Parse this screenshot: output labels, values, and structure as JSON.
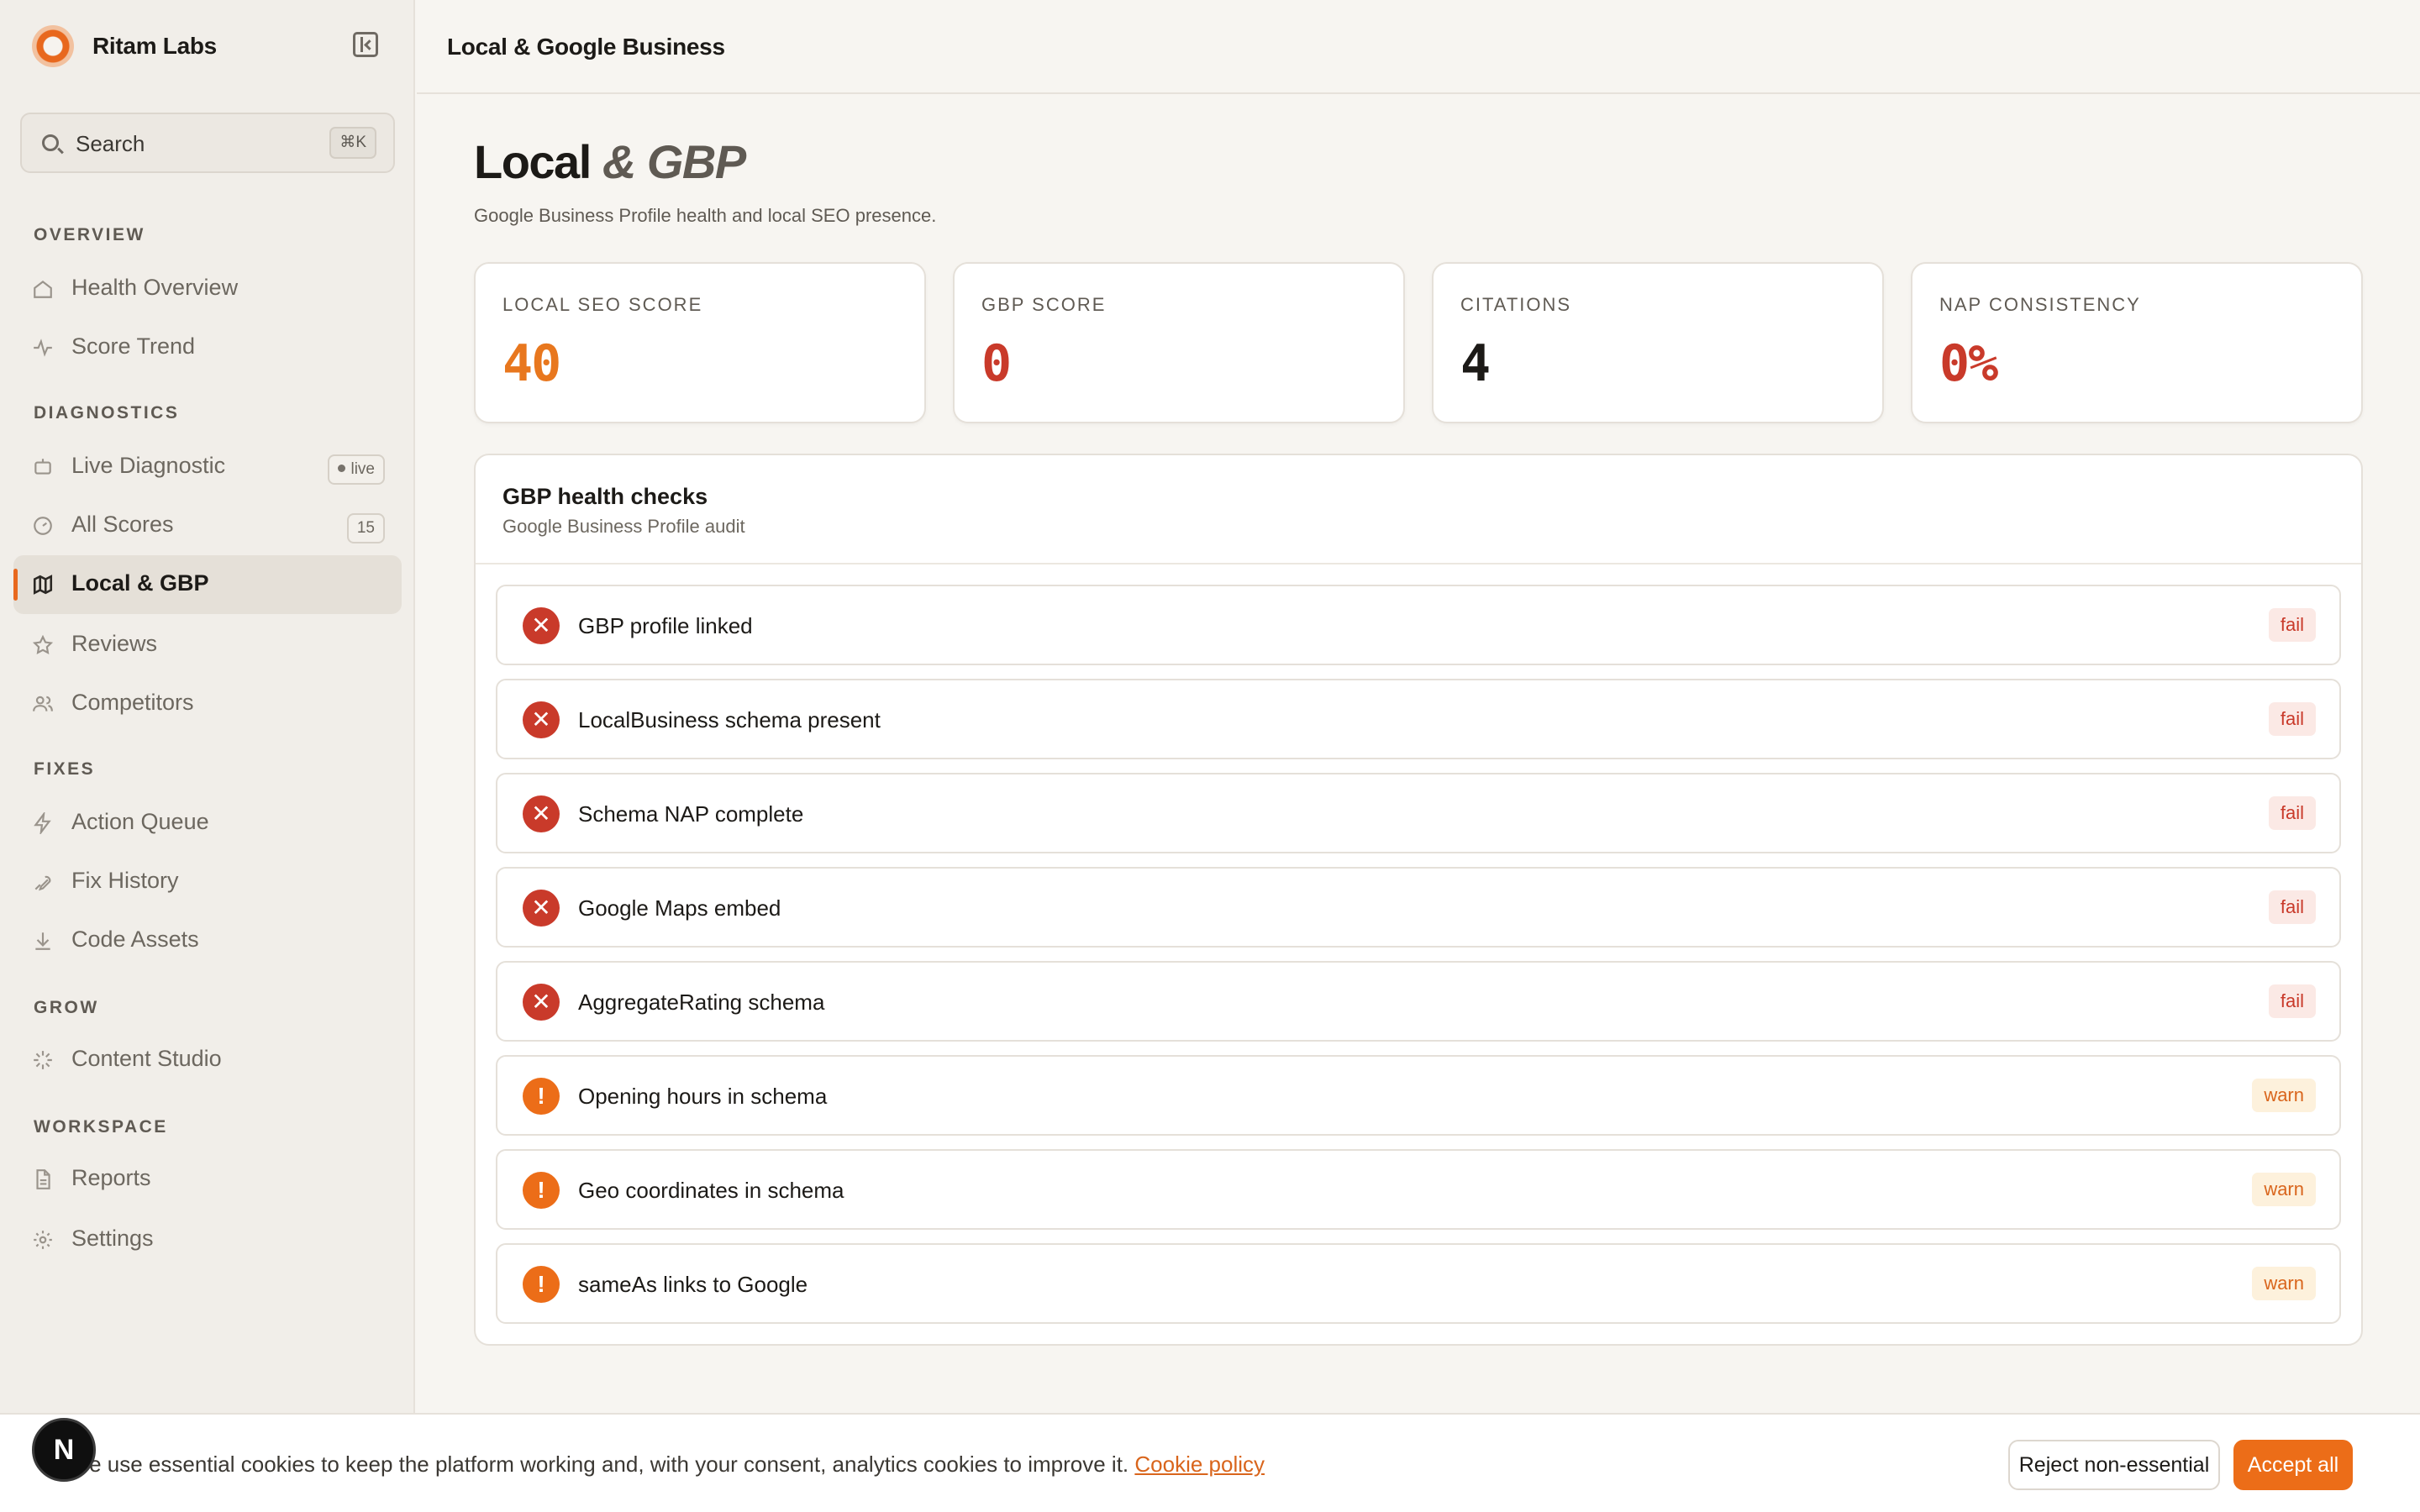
{
  "brand": {
    "name": "Ritam Labs"
  },
  "search": {
    "placeholder": "Search",
    "shortcut": "⌘K"
  },
  "sidebar": {
    "sections": [
      {
        "label": "OVERVIEW"
      },
      {
        "label": "DIAGNOSTICS"
      },
      {
        "label": "FIXES"
      },
      {
        "label": "GROW"
      },
      {
        "label": "WORKSPACE"
      }
    ],
    "items": [
      {
        "label": "Health Overview",
        "icon": "home-icon"
      },
      {
        "label": "Score Trend",
        "icon": "activity-icon"
      },
      {
        "label": "Live Diagnostic",
        "icon": "bot-icon",
        "badge": "live"
      },
      {
        "label": "All Scores",
        "icon": "gauge-icon",
        "badge": "15"
      },
      {
        "label": "Local & GBP",
        "icon": "map-icon",
        "active": true
      },
      {
        "label": "Reviews",
        "icon": "star-icon"
      },
      {
        "label": "Competitors",
        "icon": "users-icon"
      },
      {
        "label": "Action Queue",
        "icon": "zap-icon"
      },
      {
        "label": "Fix History",
        "icon": "wrench-icon"
      },
      {
        "label": "Code Assets",
        "icon": "download-icon"
      },
      {
        "label": "Content Studio",
        "icon": "sparkle-icon"
      },
      {
        "label": "Reports",
        "icon": "file-icon"
      },
      {
        "label": "Settings",
        "icon": "gear-icon"
      }
    ]
  },
  "topbar": {
    "title": "Local & Google Business"
  },
  "page": {
    "title_main": "Local",
    "title_accent": "& GBP",
    "subtitle": "Google Business Profile health and local SEO presence."
  },
  "stats": [
    {
      "label": "LOCAL SEO SCORE",
      "value": "40",
      "color": "#e8771e"
    },
    {
      "label": "GBP SCORE",
      "value": "0",
      "color": "#c93a2a"
    },
    {
      "label": "CITATIONS",
      "value": "4",
      "color": "#1c1a17"
    },
    {
      "label": "NAP CONSISTENCY",
      "value": "0%",
      "color": "#c93a2a"
    }
  ],
  "checks": {
    "title": "GBP health checks",
    "subtitle": "Google Business Profile audit",
    "items": [
      {
        "label": "GBP profile linked",
        "status": "fail"
      },
      {
        "label": "LocalBusiness schema present",
        "status": "fail"
      },
      {
        "label": "Schema NAP complete",
        "status": "fail"
      },
      {
        "label": "Google Maps embed",
        "status": "fail"
      },
      {
        "label": "AggregateRating schema",
        "status": "fail"
      },
      {
        "label": "Opening hours in schema",
        "status": "warn"
      },
      {
        "label": "Geo coordinates in schema",
        "status": "warn"
      },
      {
        "label": "sameAs links to Google",
        "status": "warn"
      }
    ]
  },
  "cookie": {
    "text": "We use essential cookies to keep the platform working and, with your consent, analytics cookies to improve it.",
    "link": "Cookie policy",
    "reject": "Reject non-essential",
    "accept": "Accept all"
  },
  "devtools": {
    "badge": "N"
  },
  "colors": {
    "accent": "#ec6d18",
    "fail": "#c93a2a",
    "warn": "#ec6d18"
  }
}
